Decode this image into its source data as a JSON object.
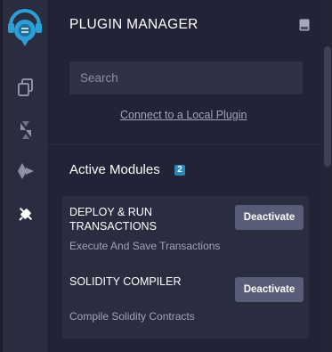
{
  "rail": {
    "icons": [
      "remix-logo-icon",
      "file-explorer-icon",
      "solidity-compiler-icon",
      "deploy-run-icon",
      "plugin-manager-icon"
    ],
    "active": "plugin-manager-icon"
  },
  "panel": {
    "title": "PLUGIN MANAGER",
    "header_icon": "book-icon",
    "search_placeholder": "Search",
    "local_plugin_link": "Connect to a Local Plugin"
  },
  "active_modules": {
    "title": "Active Modules",
    "count": "2",
    "items": [
      {
        "name": "DEPLOY & RUN TRANSACTIONS",
        "description": "Execute And Save Transactions",
        "action": "Deactivate"
      },
      {
        "name": "SOLIDITY COMPILER",
        "description": "Compile Solidity Contracts",
        "action": "Deactivate"
      }
    ]
  },
  "colors": {
    "background": "#222336",
    "rail": "#2a2c3f",
    "card": "#2a2c3f",
    "button": "#595c76",
    "badge": "#2a88b8",
    "logo": "#2b9fd6"
  }
}
